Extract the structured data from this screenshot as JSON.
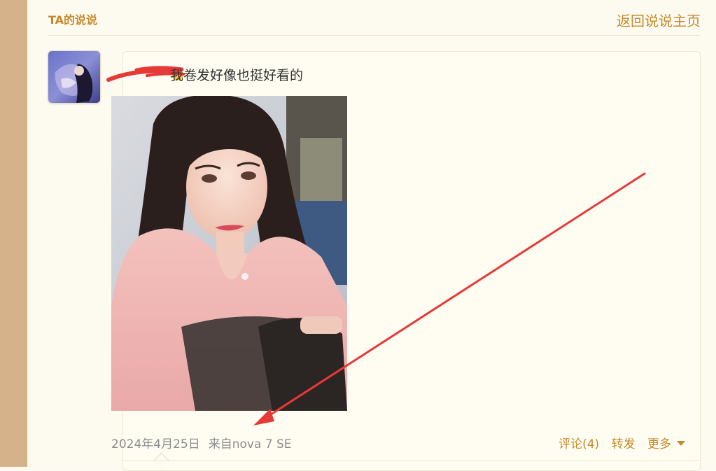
{
  "header": {
    "title": "TA的说说",
    "back_link": "返回说说主页"
  },
  "post": {
    "text": "我卷发好像也挺好看的",
    "date": "2024年4月25日",
    "source": "来自nova 7 SE",
    "actions": {
      "comment": "评论(4)",
      "repost": "转发",
      "more": "更多"
    }
  },
  "icons": {
    "caret": "caret-down-icon",
    "avatar": "user-avatar",
    "annotation": "red-arrow-annotation"
  },
  "colors": {
    "accent": "#c38a2a",
    "sidebar": "#d5b28a",
    "annotation": "#e63a37"
  }
}
